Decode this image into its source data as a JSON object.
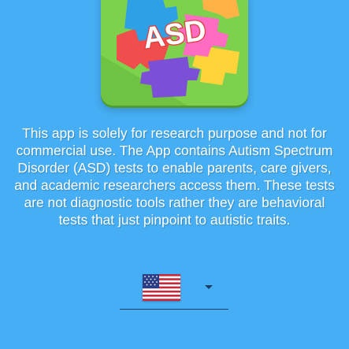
{
  "logo": {
    "text": "ASD",
    "icon": "autism-puzzle-logo-icon"
  },
  "disclaimer": {
    "text": "This app is solely for research purpose and not for commercial use. The App contains Autism Spectrum Disorder (ASD) tests to enable parents, care givers, and academic researchers access them. These tests are not diagnostic tools rather they are behavioral tests that just pinpoint to autistic traits."
  },
  "language": {
    "selected_icon": "us-flag-icon",
    "dropdown_icon": "dropdown-arrow-icon"
  },
  "colors": {
    "background": "#46aef4",
    "logo_background": "#7ed14c",
    "text": "#ffffff",
    "underline": "#1d3f66"
  }
}
